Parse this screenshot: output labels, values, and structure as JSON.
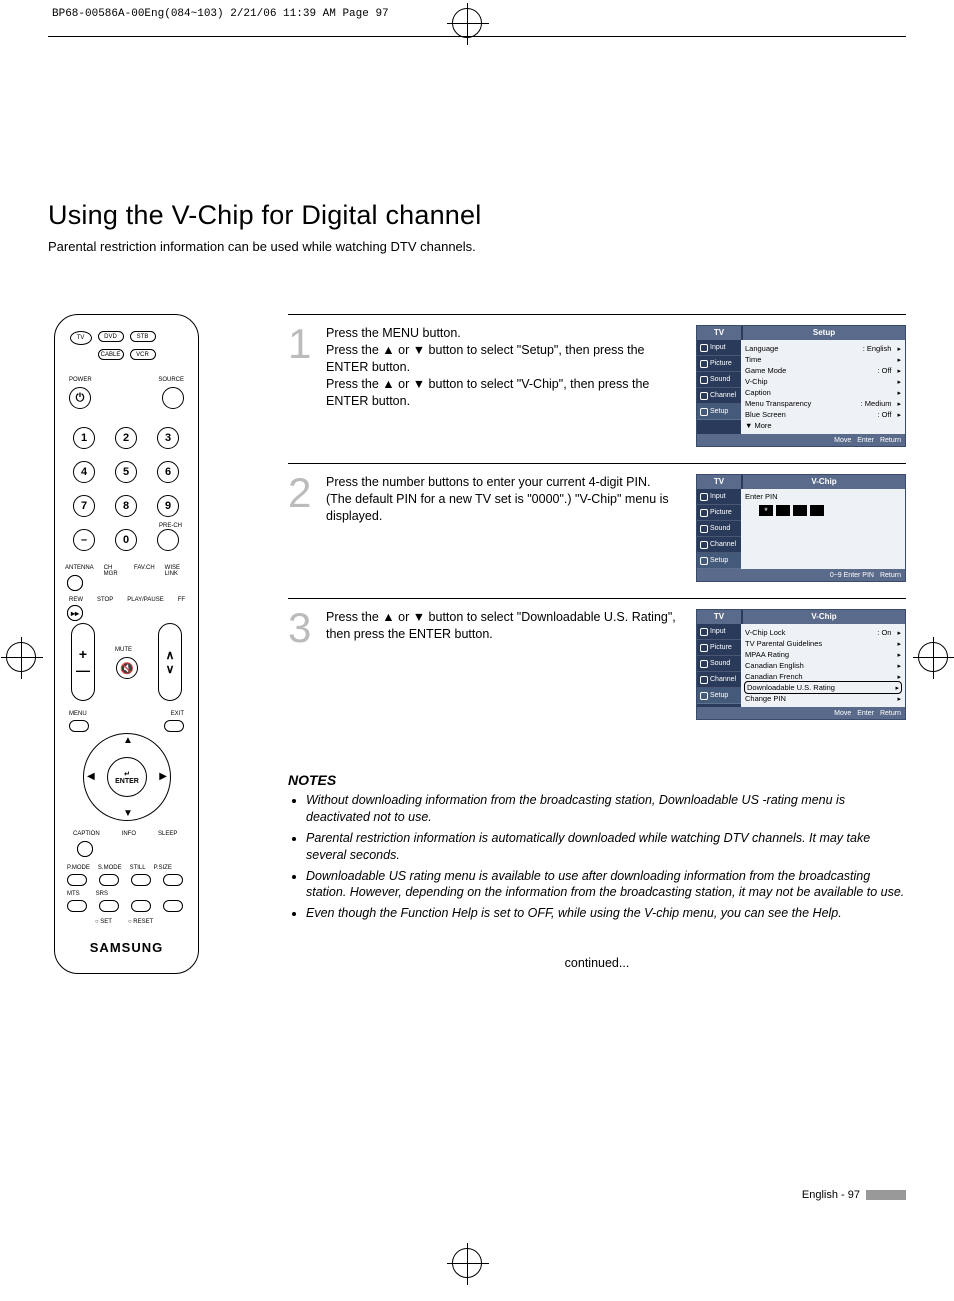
{
  "print_header": "BP68-00586A-00Eng(084~103)  2/21/06  11:39 AM  Page 97",
  "title": "Using the V-Chip for Digital channel",
  "intro": "Parental restriction information can be used while watching DTV channels.",
  "remote": {
    "modes": [
      "TV",
      "DVD",
      "STB",
      "CABLE",
      "VCR"
    ],
    "power": "POWER",
    "source": "SOURCE",
    "numbers": [
      "1",
      "2",
      "3",
      "4",
      "5",
      "6",
      "7",
      "8",
      "9",
      "–",
      "0"
    ],
    "prech": "PRE-CH",
    "row_labels": [
      "ANTENNA",
      "CH MGR",
      "FAV.CH",
      "WISE LINK"
    ],
    "transport": [
      "REW",
      "STOP",
      "PLAY/PAUSE",
      "FF"
    ],
    "vol": "VOL",
    "ch": "CH",
    "mute": "MUTE",
    "menu": "MENU",
    "exit": "EXIT",
    "enter": "ENTER",
    "bottom1": [
      "CAPTION",
      "INFO",
      "SLEEP"
    ],
    "bottom2": [
      "P.MODE",
      "S.MODE",
      "STILL",
      "P.SIZE"
    ],
    "bottom3": [
      "MTS",
      "SRS"
    ],
    "setreset": [
      "SET",
      "RESET"
    ],
    "brand": "SAMSUNG"
  },
  "steps": [
    {
      "num": "1",
      "text": "Press the MENU button.\nPress the ▲ or ▼ button to select \"Setup\", then press the ENTER button.\nPress the ▲ or ▼ button to select \"V-Chip\", then press the ENTER button.",
      "osd": {
        "tv": "TV",
        "title": "Setup",
        "side": [
          "Input",
          "Picture",
          "Sound",
          "Channel",
          "Setup"
        ],
        "rows": [
          {
            "l": "Language",
            "r": ": English",
            "a": "▸"
          },
          {
            "l": "Time",
            "r": "",
            "a": "▸"
          },
          {
            "l": "Game Mode",
            "r": ": Off",
            "a": "▸"
          },
          {
            "l": "V-Chip",
            "r": "",
            "a": "▸"
          },
          {
            "l": "Caption",
            "r": "",
            "a": "▸"
          },
          {
            "l": "Menu Transparency",
            "r": ": Medium",
            "a": "▸"
          },
          {
            "l": "Blue Screen",
            "r": ": Off",
            "a": "▸"
          },
          {
            "l": "▼ More",
            "r": "",
            "a": ""
          }
        ],
        "footer": [
          "Move",
          "Enter",
          "Return"
        ]
      }
    },
    {
      "num": "2",
      "text": "Press the number buttons to enter your current 4-digit PIN. (The default PIN for a new TV set is \"0000\".) \"V-Chip\" menu is displayed.",
      "osd": {
        "tv": "TV",
        "title": "V-Chip",
        "side": [
          "Input",
          "Picture",
          "Sound",
          "Channel",
          "Setup"
        ],
        "enter_pin": "Enter PIN",
        "footer": [
          "0~9 Enter PIN",
          "Return"
        ]
      }
    },
    {
      "num": "3",
      "text": "Press the ▲ or ▼ button to select \"Downloadable U.S. Rating\", then press the ENTER button.",
      "osd": {
        "tv": "TV",
        "title": "V-Chip",
        "side": [
          "Input",
          "Picture",
          "Sound",
          "Channel",
          "Setup"
        ],
        "rows": [
          {
            "l": "V-Chip Lock",
            "r": ": On",
            "a": "▸"
          },
          {
            "l": "TV Parental Guidelines",
            "r": "",
            "a": "▸"
          },
          {
            "l": "MPAA Rating",
            "r": "",
            "a": "▸"
          },
          {
            "l": "Canadian English",
            "r": "",
            "a": "▸"
          },
          {
            "l": "Canadian French",
            "r": "",
            "a": "▸"
          },
          {
            "l": "Downloadable U.S. Rating",
            "r": "",
            "a": "▸",
            "sel": true
          },
          {
            "l": "Change PIN",
            "r": "",
            "a": "▸"
          }
        ],
        "footer": [
          "Move",
          "Enter",
          "Return"
        ]
      }
    }
  ],
  "notes_title": "NOTES",
  "notes": [
    "Without downloading information from the broadcasting station, Downloadable US -rating menu is deactivated not to use.",
    "Parental restriction information is automatically downloaded while watching DTV channels. It may take several seconds.",
    "Downloadable US rating menu is available to use after downloading information from the broadcasting station. However, depending on the information from the broadcasting station, it may not be available to use.",
    "Even though the Function Help is set to OFF, while using the V-chip menu, you can see the Help."
  ],
  "continued": "continued...",
  "footer": "English - 97"
}
